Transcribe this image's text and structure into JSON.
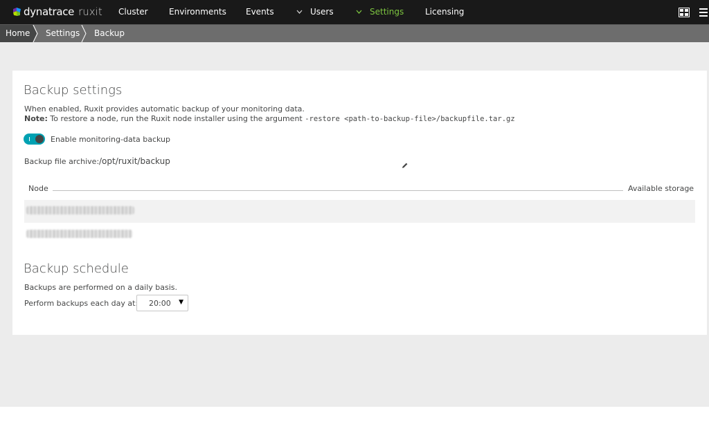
{
  "topnav": {
    "logo_brand": "dynatrace",
    "logo_product": "ruxit",
    "items": [
      {
        "label": "Cluster"
      },
      {
        "label": "Environments"
      },
      {
        "label": "Events"
      },
      {
        "label": "Users"
      },
      {
        "label": "Settings"
      },
      {
        "label": "Licensing"
      }
    ],
    "active_color": "#7dc540",
    "background": "#191919",
    "icons": [
      "chevron-down-icon",
      "chevron-down-icon",
      "dashboard-icon",
      "menu-icon"
    ]
  },
  "breadcrumb": {
    "items": [
      {
        "label": "Home"
      },
      {
        "label": "Settings"
      },
      {
        "label": "Backup"
      }
    ]
  },
  "backup_settings": {
    "title": "Backup settings",
    "description": "When enabled, Ruxit provides automatic backup of your monitoring data.",
    "note_label": "Note:",
    "note_text": "To restore a node, run the Ruxit node installer using the argument",
    "note_code": "-restore <path-to-backup-file>/backupfile.tar.gz",
    "toggle_label": "Enable monitoring-data backup",
    "toggle_on": true,
    "toggle_color": "#00a1b2",
    "archive_label": "Backup file archive:",
    "archive_path": "/opt/ruxit/backup",
    "table": {
      "col_node": "Node",
      "col_storage": "Available storage"
    }
  },
  "backup_schedule": {
    "title": "Backup schedule",
    "description": "Backups are performed on a daily basis.",
    "time_label": "Perform backups each day at:",
    "time_value": "20:00"
  }
}
